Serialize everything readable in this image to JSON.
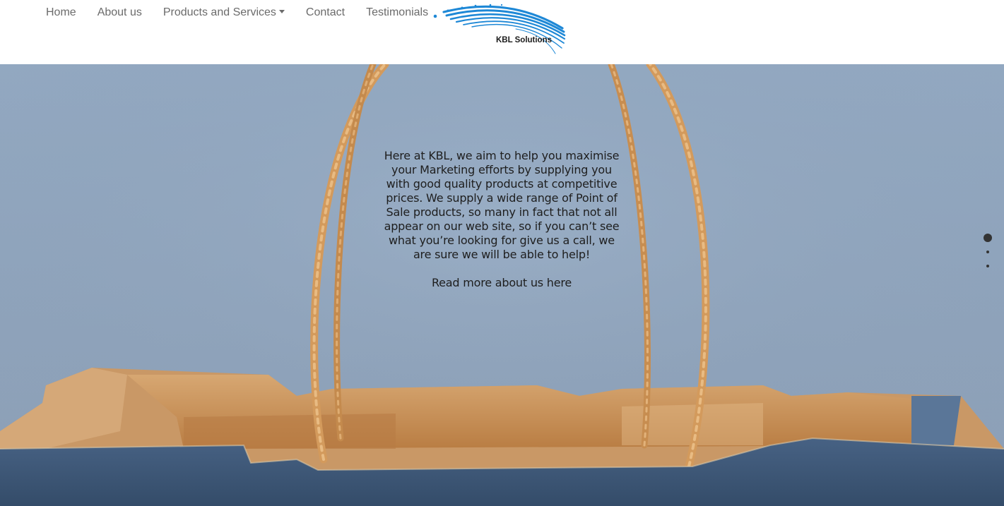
{
  "nav": {
    "items": [
      {
        "label": "Home"
      },
      {
        "label": "About us"
      },
      {
        "label": "Products and Services"
      },
      {
        "label": "Contact"
      },
      {
        "label": "Testimonials"
      }
    ]
  },
  "logo": {
    "text": "KBL Solutions",
    "color": "#1e88d6"
  },
  "hero": {
    "paragraph": "Here at KBL, we aim to help you maximise your Marketing efforts by supplying you with good quality products at competitive prices. We supply a wide range of Point of Sale products, so many in fact that not all appear on our web site, so if you can’t see what you’re looking for give us a call, we are sure we will be able to help!",
    "link": "Read more about us here"
  },
  "carousel": {
    "slide_count": 3,
    "active_slide": 1
  },
  "colors": {
    "wall": "#93a7bf",
    "paper": "#c9965f",
    "denim": "#3f5978",
    "logo_blue": "#1e88d6"
  }
}
